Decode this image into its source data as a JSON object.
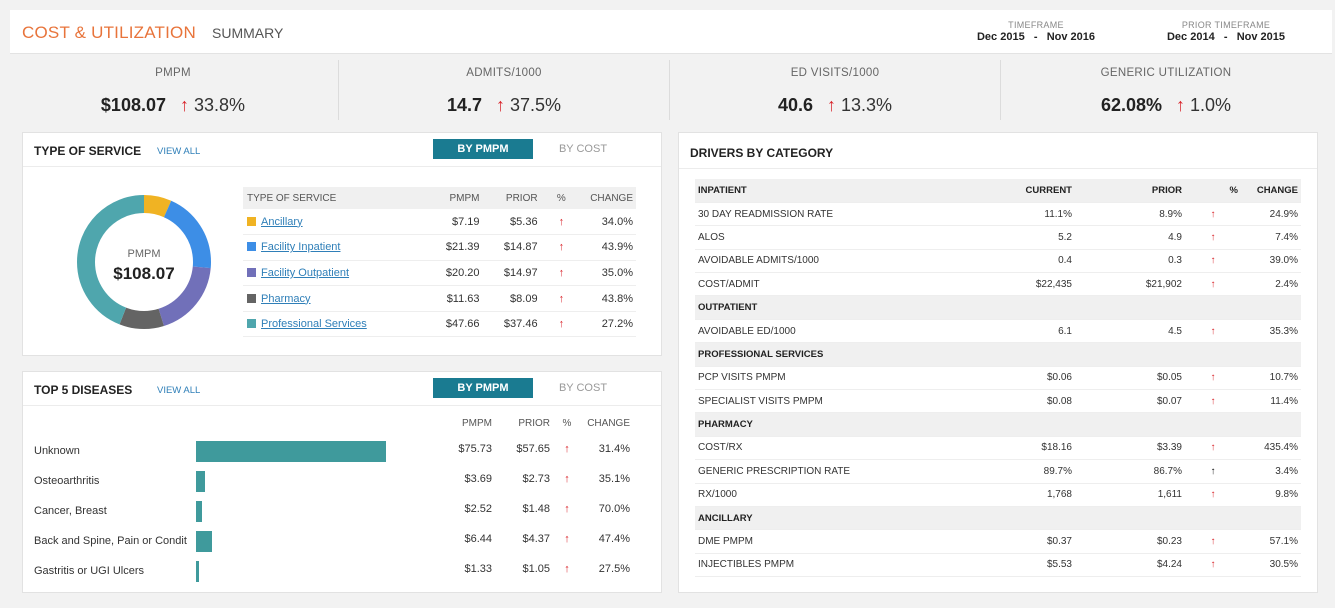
{
  "header": {
    "title": "COST & UTILIZATION",
    "subtitle": "SUMMARY",
    "timeframe": {
      "label": "TIMEFRAME",
      "value": "Dec 2015   -   Nov 2016"
    },
    "prior_timeframe": {
      "label": "PRIOR TIMEFRAME",
      "value": "Dec 2014   -   Nov 2015"
    }
  },
  "kpis": [
    {
      "label": "PMPM",
      "value": "$108.07",
      "change": "33.8%",
      "arrow": "↑"
    },
    {
      "label": "ADMITS/1000",
      "value": "14.7",
      "change": "37.5%",
      "arrow": "↑"
    },
    {
      "label": "ED VISITS/1000",
      "value": "40.6",
      "change": "13.3%",
      "arrow": "↑"
    },
    {
      "label": "GENERIC UTILIZATION",
      "value": "62.08%",
      "change": "1.0%",
      "arrow": "↑"
    }
  ],
  "type_of_service": {
    "title": "TYPE OF SERVICE",
    "view_all": "VIEW ALL",
    "tab_active": "BY PMPM",
    "tab_inactive": "BY COST",
    "donut_label": "PMPM",
    "donut_value": "$108.07",
    "columns": [
      "TYPE OF SERVICE",
      "PMPM",
      "PRIOR",
      "%",
      "CHANGE"
    ],
    "rows": [
      {
        "name": "Ancillary",
        "pmpm": "$7.19",
        "prior": "$5.36",
        "arrow": "↑",
        "change": "34.0%",
        "color": "#f0b323",
        "share": 7.19
      },
      {
        "name": "Facility Inpatient",
        "pmpm": "$21.39",
        "prior": "$14.87",
        "arrow": "↑",
        "change": "43.9%",
        "color": "#3d8ee6",
        "share": 21.39
      },
      {
        "name": "Facility Outpatient",
        "pmpm": "$20.20",
        "prior": "$14.97",
        "arrow": "↑",
        "change": "35.0%",
        "color": "#7170b9",
        "share": 20.2
      },
      {
        "name": "Pharmacy",
        "pmpm": "$11.63",
        "prior": "$8.09",
        "arrow": "↑",
        "change": "43.8%",
        "color": "#646464",
        "share": 11.63
      },
      {
        "name": "Professional Services",
        "pmpm": "$47.66",
        "prior": "$37.46",
        "arrow": "↑",
        "change": "27.2%",
        "color": "#4fa6ad",
        "share": 47.66
      }
    ]
  },
  "top_diseases": {
    "title": "TOP 5 DISEASES",
    "view_all": "VIEW ALL",
    "tab_active": "BY PMPM",
    "tab_inactive": "BY COST",
    "columns": [
      "PMPM",
      "PRIOR",
      "%",
      "CHANGE"
    ],
    "rows": [
      {
        "name": "Unknown",
        "pmpm": "$75.73",
        "prior": "$57.65",
        "arrow": "↑",
        "change": "31.4%",
        "value": 75.73
      },
      {
        "name": "Osteoarthritis",
        "pmpm": "$3.69",
        "prior": "$2.73",
        "arrow": "↑",
        "change": "35.1%",
        "value": 3.69
      },
      {
        "name": "Cancer, Breast",
        "pmpm": "$2.52",
        "prior": "$1.48",
        "arrow": "↑",
        "change": "70.0%",
        "value": 2.52
      },
      {
        "name": "Back and Spine, Pain or Condit",
        "pmpm": "$6.44",
        "prior": "$4.37",
        "arrow": "↑",
        "change": "47.4%",
        "value": 6.44
      },
      {
        "name": "Gastritis or UGI Ulcers",
        "pmpm": "$1.33",
        "prior": "$1.05",
        "arrow": "↑",
        "change": "27.5%",
        "value": 1.33
      }
    ]
  },
  "drivers": {
    "title": "DRIVERS BY CATEGORY",
    "columns": [
      "CURRENT",
      "PRIOR",
      "%",
      "CHANGE"
    ],
    "sections": [
      {
        "name": "INPATIENT",
        "rows": [
          {
            "name": "30 DAY READMISSION RATE",
            "current": "11.1%",
            "prior": "8.9%",
            "arrow": "↑",
            "arrow_color": "red",
            "change": "24.9%"
          },
          {
            "name": "ALOS",
            "current": "5.2",
            "prior": "4.9",
            "arrow": "↑",
            "arrow_color": "red",
            "change": "7.4%"
          },
          {
            "name": "AVOIDABLE ADMITS/1000",
            "current": "0.4",
            "prior": "0.3",
            "arrow": "↑",
            "arrow_color": "red",
            "change": "39.0%"
          },
          {
            "name": "COST/ADMIT",
            "current": "$22,435",
            "prior": "$21,902",
            "arrow": "↑",
            "arrow_color": "red",
            "change": "2.4%"
          }
        ]
      },
      {
        "name": "OUTPATIENT",
        "rows": [
          {
            "name": "AVOIDABLE ED/1000",
            "current": "6.1",
            "prior": "4.5",
            "arrow": "↑",
            "arrow_color": "red",
            "change": "35.3%"
          }
        ]
      },
      {
        "name": "PROFESSIONAL SERVICES",
        "rows": [
          {
            "name": "PCP VISITS PMPM",
            "current": "$0.06",
            "prior": "$0.05",
            "arrow": "↑",
            "arrow_color": "red",
            "change": "10.7%"
          },
          {
            "name": "SPECIALIST VISITS PMPM",
            "current": "$0.08",
            "prior": "$0.07",
            "arrow": "↑",
            "arrow_color": "red",
            "change": "11.4%"
          }
        ]
      },
      {
        "name": "PHARMACY",
        "rows": [
          {
            "name": "COST/RX",
            "current": "$18.16",
            "prior": "$3.39",
            "arrow": "↑",
            "arrow_color": "red",
            "change": "435.4%"
          },
          {
            "name": "GENERIC PRESCRIPTION RATE",
            "current": "89.7%",
            "prior": "86.7%",
            "arrow": "↑",
            "arrow_color": "black",
            "change": "3.4%"
          },
          {
            "name": "RX/1000",
            "current": "1,768",
            "prior": "1,611",
            "arrow": "↑",
            "arrow_color": "red",
            "change": "9.8%"
          }
        ]
      },
      {
        "name": "ANCILLARY",
        "rows": [
          {
            "name": "DME PMPM",
            "current": "$0.37",
            "prior": "$0.23",
            "arrow": "↑",
            "arrow_color": "red",
            "change": "57.1%"
          },
          {
            "name": "INJECTIBLES PMPM",
            "current": "$5.53",
            "prior": "$4.24",
            "arrow": "↑",
            "arrow_color": "red",
            "change": "30.5%"
          }
        ]
      }
    ]
  }
}
